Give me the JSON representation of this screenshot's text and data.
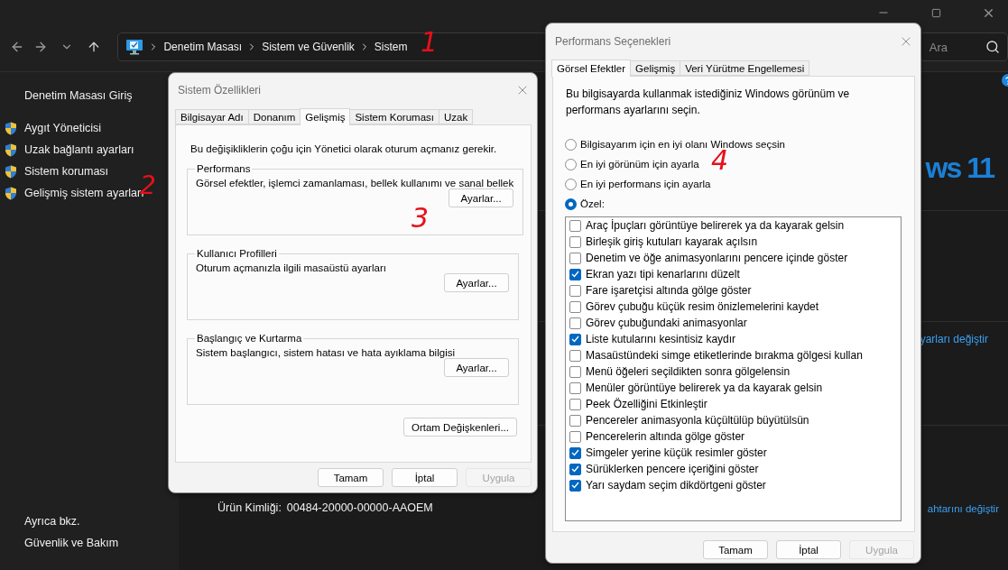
{
  "window": {
    "breadcrumb": [
      "Denetim Masası",
      "Sistem ve Güvenlik",
      "Sistem"
    ],
    "search": {
      "placeholder": "Ara"
    }
  },
  "sidebar": {
    "home": "Denetim Masası Giriş",
    "items": [
      "Aygıt Yöneticisi",
      "Uzak bağlantı ayarları",
      "Sistem koruması",
      "Gelişmiş sistem ayarları"
    ],
    "see_also_title": "Ayrıca bkz.",
    "see_also": [
      "Güvenlik ve Bakım"
    ]
  },
  "content": {
    "logo": "ws 11",
    "link_1": "yarları değiştir",
    "product_id_label": "Ürün Kimliği:",
    "product_id": "00484-20000-00000-AAOEM",
    "link_2": "ahtarını değiştir"
  },
  "annotations": [
    "1",
    "2",
    "3",
    "4"
  ],
  "system_properties": {
    "title": "Sistem Özellikleri",
    "tabs": [
      {
        "label": "Bilgisayar Adı",
        "selected": false
      },
      {
        "label": "Donanım",
        "selected": false
      },
      {
        "label": "Gelişmiş",
        "selected": true
      },
      {
        "label": "Sistem Koruması",
        "selected": false
      },
      {
        "label": "Uzak",
        "selected": false
      }
    ],
    "note": "Bu değişikliklerin çoğu için Yönetici olarak oturum açmanız gerekir.",
    "groups": [
      {
        "title": "Performans",
        "description": "Görsel efektler, işlemci zamanlaması, bellek kullanımı ve sanal bellek",
        "button": "Ayarlar..."
      },
      {
        "title": "Kullanıcı Profilleri",
        "description": "Oturum açmanızla ilgili masaüstü ayarları",
        "button": "Ayarlar..."
      },
      {
        "title": "Başlangıç ve Kurtarma",
        "description": "Sistem başlangıcı, sistem hatası ve hata ayıklama bilgisi",
        "button": "Ayarlar..."
      }
    ],
    "env_button": "Ortam Değişkenleri...",
    "buttons": [
      {
        "label": "Tamam",
        "disabled": false
      },
      {
        "label": "İptal",
        "disabled": false
      },
      {
        "label": "Uygula",
        "disabled": true
      }
    ]
  },
  "performance_options": {
    "title": "Performans Seçenekleri",
    "tabs": [
      {
        "label": "Görsel Efektler",
        "selected": true
      },
      {
        "label": "Gelişmiş",
        "selected": false
      },
      {
        "label": "Veri Yürütme Engellemesi",
        "selected": false
      }
    ],
    "description": "Bu bilgisayarda kullanmak istediğiniz Windows görünüm ve performans ayarlarını seçin.",
    "options": [
      {
        "label": "Bilgisayarım için en iyi olanı Windows seçsin",
        "selected": false
      },
      {
        "label": "En iyi görünüm için ayarla",
        "selected": false
      },
      {
        "label": "En iyi performans için ayarla",
        "selected": false
      },
      {
        "label": "Özel:",
        "selected": true
      }
    ],
    "effects": [
      {
        "label": "Araç İpuçları görüntüye belirerek ya da kayarak gelsin",
        "checked": false
      },
      {
        "label": "Birleşik giriş kutuları kayarak açılsın",
        "checked": false
      },
      {
        "label": "Denetim ve öğe animasyonlarını pencere içinde göster",
        "checked": false
      },
      {
        "label": "Ekran yazı tipi kenarlarını düzelt",
        "checked": true
      },
      {
        "label": "Fare işaretçisi altında gölge göster",
        "checked": false
      },
      {
        "label": "Görev çubuğu küçük resim önizlemelerini kaydet",
        "checked": false
      },
      {
        "label": "Görev çubuğundaki animasyonlar",
        "checked": false
      },
      {
        "label": "Liste kutularını kesintisiz kaydır",
        "checked": true
      },
      {
        "label": "Masaüstündeki simge etiketlerinde bırakma gölgesi kullan",
        "checked": false
      },
      {
        "label": "Menü öğeleri seçildikten sonra gölgelensin",
        "checked": false
      },
      {
        "label": "Menüler görüntüye belirerek ya da kayarak gelsin",
        "checked": false
      },
      {
        "label": "Peek Özelliğini Etkinleştir",
        "checked": false
      },
      {
        "label": "Pencereler animasyonla küçültülüp büyütülsün",
        "checked": false
      },
      {
        "label": "Pencerelerin altında gölge göster",
        "checked": false
      },
      {
        "label": "Simgeler yerine küçük resimler göster",
        "checked": true
      },
      {
        "label": "Sürüklerken pencere içeriğini göster",
        "checked": true
      },
      {
        "label": "Yarı saydam seçim dikdörtgeni göster",
        "checked": true
      }
    ],
    "buttons": [
      {
        "label": "Tamam",
        "disabled": false
      },
      {
        "label": "İptal",
        "disabled": false
      },
      {
        "label": "Uygula",
        "disabled": true
      }
    ]
  }
}
